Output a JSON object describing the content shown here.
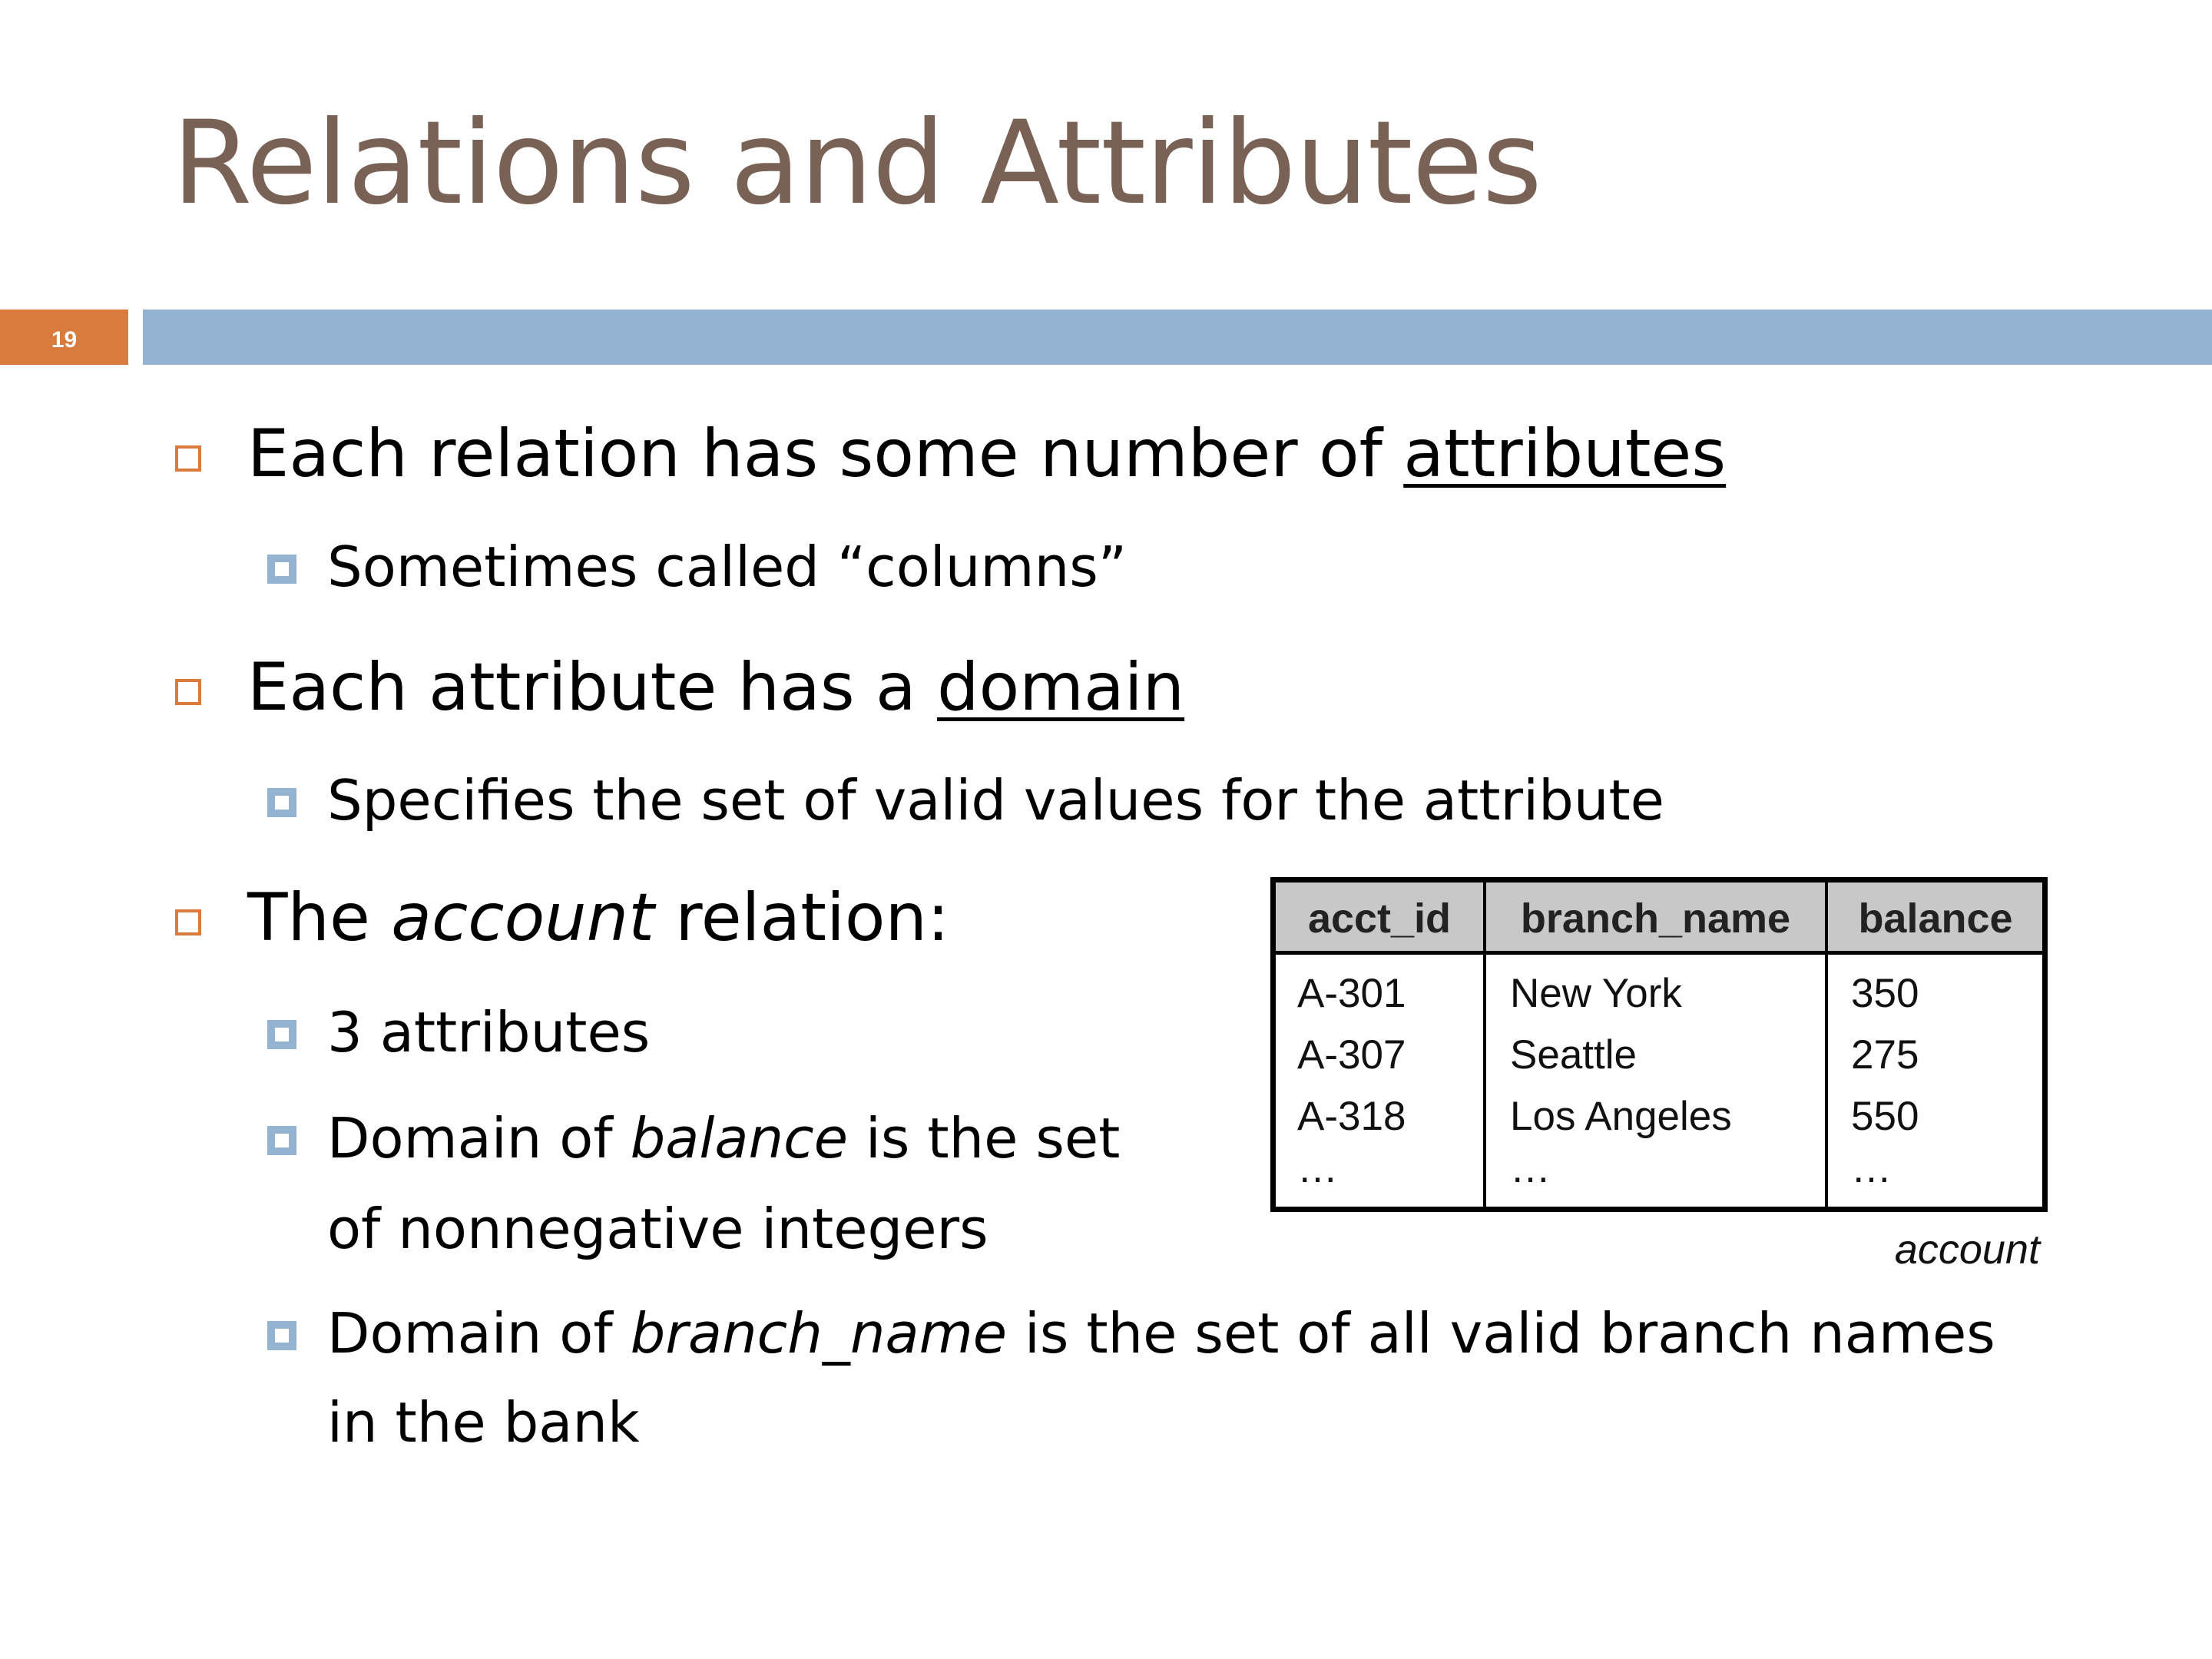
{
  "slide": {
    "title": "Relations and Attributes",
    "number": "19"
  },
  "bullets": {
    "b1": {
      "pre": "Each relation has some number of ",
      "term": "attributes"
    },
    "b1a": "Sometimes called “columns”",
    "b2": {
      "pre": "Each attribute has a ",
      "term": "domain"
    },
    "b2a": "Specifies the set of valid values for the attribute",
    "b3": {
      "pre": "The ",
      "term": "account",
      "post": " relation:"
    },
    "b3a": "3 attributes",
    "b3b": {
      "pre": "Domain of ",
      "term": "balance",
      "post": " is the set",
      "line2": "of nonnegative integers"
    },
    "b3c": {
      "pre": "Domain of ",
      "term": "branch_name",
      "post": " is the set of all valid branch names",
      "line2": "in the bank"
    }
  },
  "table": {
    "headers": [
      "acct_id",
      "branch_name",
      "balance"
    ],
    "rows": [
      [
        "A-301",
        "New York",
        "350"
      ],
      [
        "A-307",
        "Seattle",
        "275"
      ],
      [
        "A-318",
        "Los Angeles",
        "550"
      ],
      [
        "…",
        "…",
        "…"
      ]
    ],
    "caption": "account"
  }
}
